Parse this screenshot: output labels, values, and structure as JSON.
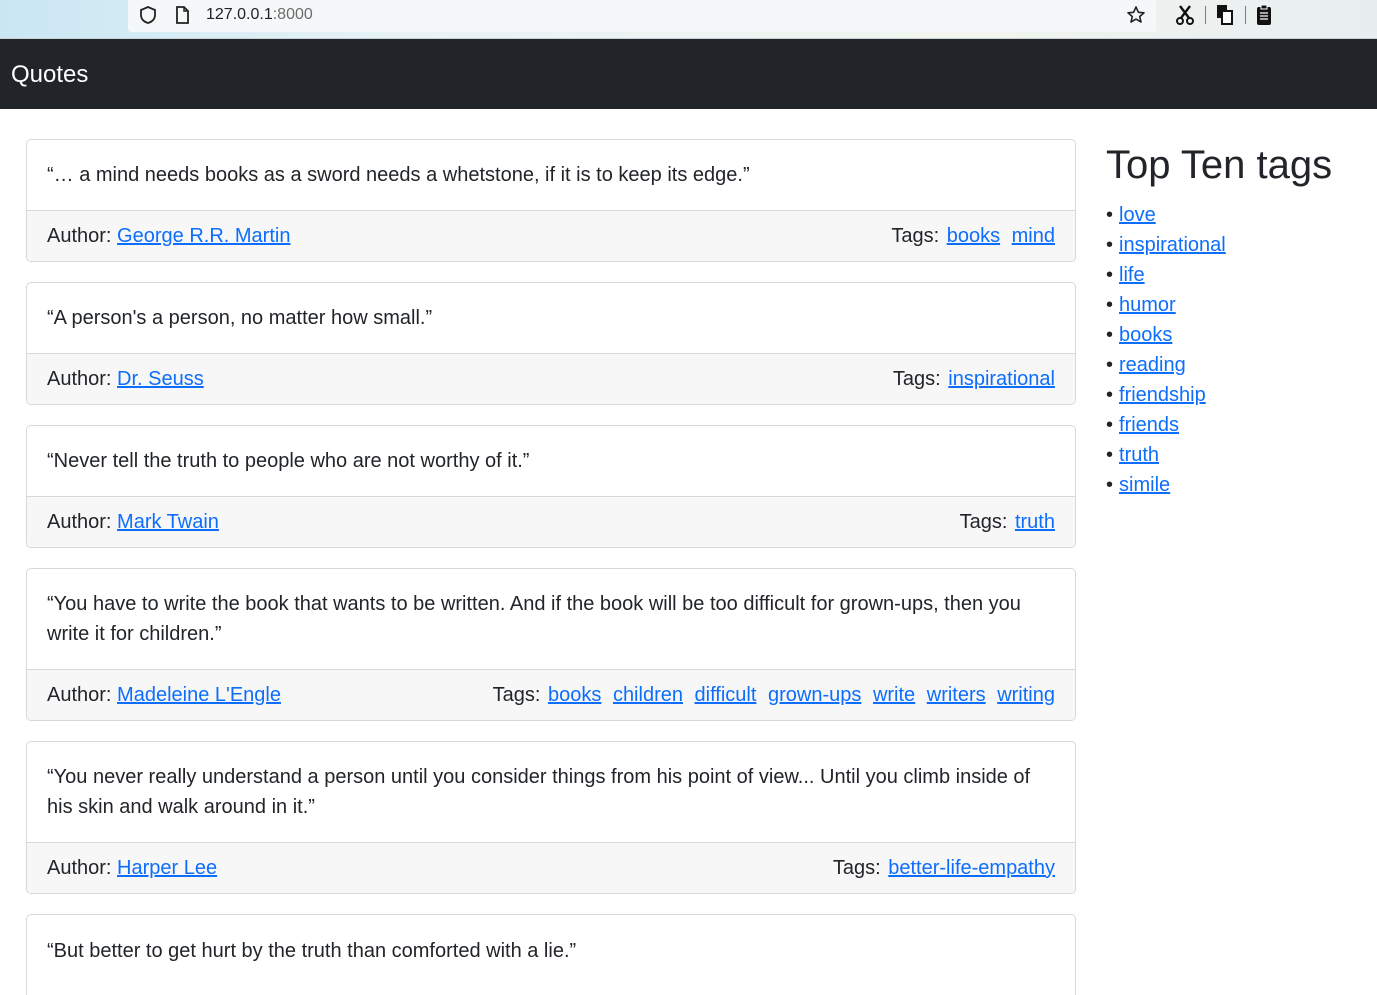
{
  "browser": {
    "url_host": "127.0.0.1",
    "url_port": ":8000"
  },
  "navbar": {
    "brand": "Quotes"
  },
  "quotes": [
    {
      "text": "“… a mind needs books as a sword needs a whetstone, if it is to keep its edge.”",
      "author_label": "Author:",
      "author": "George R.R. Martin",
      "tags_label": "Tags:",
      "tags": [
        "books",
        "mind"
      ]
    },
    {
      "text": "“A person's a person, no matter how small.”",
      "author_label": "Author:",
      "author": "Dr. Seuss",
      "tags_label": "Tags:",
      "tags": [
        "inspirational"
      ]
    },
    {
      "text": "“Never tell the truth to people who are not worthy of it.”",
      "author_label": "Author:",
      "author": "Mark Twain",
      "tags_label": "Tags:",
      "tags": [
        "truth"
      ]
    },
    {
      "text": "“You have to write the book that wants to be written. And if the book will be too difficult for grown-ups, then you write it for children.”",
      "author_label": "Author:",
      "author": "Madeleine L'Engle",
      "tags_label": "Tags:",
      "tags": [
        "books",
        "children",
        "difficult",
        "grown-ups",
        "write",
        "writers",
        "writing"
      ]
    },
    {
      "text": "“You never really understand a person until you consider things from his point of view... Until you climb inside of his skin and walk around in it.”",
      "author_label": "Author:",
      "author": "Harper Lee",
      "tags_label": "Tags:",
      "tags": [
        "better-life-empathy"
      ]
    },
    {
      "text": "“But better to get hurt by the truth than comforted with a lie.”"
    }
  ],
  "sidebar": {
    "title": "Top Ten tags",
    "tags": [
      "love",
      "inspirational",
      "life",
      "humor",
      "books",
      "reading",
      "friendship",
      "friends",
      "truth",
      "simile"
    ]
  },
  "colors": {
    "navbar_bg": "#212529",
    "link": "#0d6efd",
    "card_footer_bg": "#f7f7f7"
  }
}
